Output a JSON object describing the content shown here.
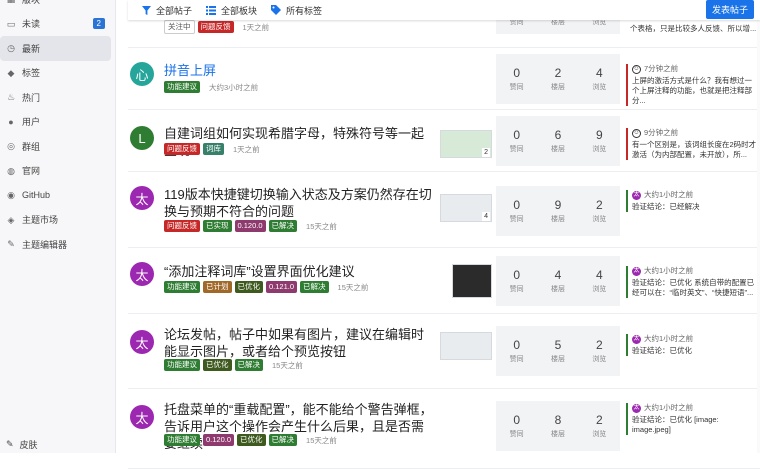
{
  "sidebar": {
    "items": [
      {
        "icon": "grid-icon",
        "label": "版块"
      },
      {
        "icon": "inbox-icon",
        "label": "未读",
        "badge": "2"
      },
      {
        "icon": "clock-icon",
        "label": "最新"
      },
      {
        "icon": "tag-icon",
        "label": "标签"
      },
      {
        "icon": "fire-icon",
        "label": "热门"
      },
      {
        "icon": "user-icon",
        "label": "用户"
      },
      {
        "icon": "group-icon",
        "label": "群组"
      },
      {
        "icon": "globe-icon",
        "label": "官网"
      },
      {
        "icon": "github-icon",
        "label": "GitHub"
      },
      {
        "icon": "store-icon",
        "label": "主题市场"
      },
      {
        "icon": "editor-icon",
        "label": "主题编辑器"
      }
    ],
    "skin": "皮肤"
  },
  "topbar": {
    "all_posts": "全部帖子",
    "all_boards": "全部板块",
    "all_tags": "所有标签",
    "new_post": "发表帖子"
  },
  "stat_labels": {
    "votes": "赞同",
    "floors": "楼层",
    "views": "浏览"
  },
  "partial": {
    "tag_a": "关注中",
    "tag_b": "问题反馈",
    "time": "1天之前",
    "last_text": "个表格，只是比较多人反馈、所以增..."
  },
  "posts": [
    {
      "avatar_char": "心",
      "avatar_color": "#26a69a",
      "title": "拼音上屏",
      "tags": [
        {
          "text": "功能建议",
          "color": "#2e7d32"
        }
      ],
      "time": "大约3小时之前",
      "votes": "0",
      "floors": "2",
      "views": "4",
      "last_who": "7分钟之前",
      "last_text": "上屏的激活方式是什么？我有想过一个上屏注释的功能，也就是把注释部分..."
    },
    {
      "avatar_char": "L",
      "avatar_color": "#2e7d32",
      "title": "自建词组如何实现希腊字母，特殊符号等一起呈现",
      "tags": [
        {
          "text": "问题反馈",
          "color": "#c62828"
        },
        {
          "text": "词库",
          "color": "#37816a"
        }
      ],
      "time": "1天之前",
      "thumb_count": "2",
      "votes": "0",
      "floors": "6",
      "views": "9",
      "last_who": "9分钟之前",
      "last_text": "有一个区别是，该词组长度在2码时才激活（为内部配置，未开放），所..."
    },
    {
      "avatar_char": "太",
      "avatar_color": "#9c27b0",
      "title": "119版本快捷键切换输入状态及方案仍然存在切换与预期不符合的问题",
      "tags": [
        {
          "text": "问题反馈",
          "color": "#c62828"
        },
        {
          "text": "已实现",
          "color": "#2e7d32"
        },
        {
          "text": "0.120.0",
          "color": "#8e3a6e"
        },
        {
          "text": "已解决",
          "color": "#2e7d32"
        }
      ],
      "time": "15天之前",
      "thumb_count": "4",
      "votes": "0",
      "floors": "9",
      "views": "2",
      "last_who": "大约1小时之前",
      "last_text": "验证结论：已经解决"
    },
    {
      "avatar_char": "太",
      "avatar_color": "#9c27b0",
      "title": "“添加注释词库”设置界面优化建议",
      "tags": [
        {
          "text": "功能建议",
          "color": "#2e7d32"
        },
        {
          "text": "已计划",
          "color": "#a0692a"
        },
        {
          "text": "已优化",
          "color": "#3e5a1e"
        },
        {
          "text": "0.121.0",
          "color": "#8e3a6e"
        },
        {
          "text": "已解决",
          "color": "#2e7d32"
        }
      ],
      "time": "15天之前",
      "votes": "0",
      "floors": "4",
      "views": "4",
      "last_who": "大约1小时之前",
      "last_text": "验证结论：已优化 系统自带的配置已经可以在：“临时英文”、“快捷短语”..."
    },
    {
      "avatar_char": "太",
      "avatar_color": "#9c27b0",
      "title": "论坛发帖，帖子中如果有图片，建议在编辑时能显示图片，或者给个预览按钮",
      "tags": [
        {
          "text": "功能建议",
          "color": "#2e7d32"
        },
        {
          "text": "已优化",
          "color": "#3e5a1e"
        },
        {
          "text": "已解决",
          "color": "#2e7d32"
        }
      ],
      "time": "15天之前",
      "votes": "0",
      "floors": "5",
      "views": "2",
      "last_who": "大约1小时之前",
      "last_text": "验证结论：已优化"
    },
    {
      "avatar_char": "太",
      "avatar_color": "#9c27b0",
      "title": "托盘菜单的“重载配置”，能不能给个警告弹框，告诉用户这个操作会产生什么后果，且是否需要继续",
      "tags": [
        {
          "text": "功能建议",
          "color": "#2e7d32"
        },
        {
          "text": "0.120.0",
          "color": "#8e3a6e"
        },
        {
          "text": "已优化",
          "color": "#3e5a1e"
        },
        {
          "text": "已解决",
          "color": "#2e7d32"
        }
      ],
      "time": "15天之前",
      "votes": "0",
      "floors": "8",
      "views": "2",
      "last_who": "大约1小时之前",
      "last_text": "验证结论：已优化 [image: image.jpeg]"
    }
  ]
}
